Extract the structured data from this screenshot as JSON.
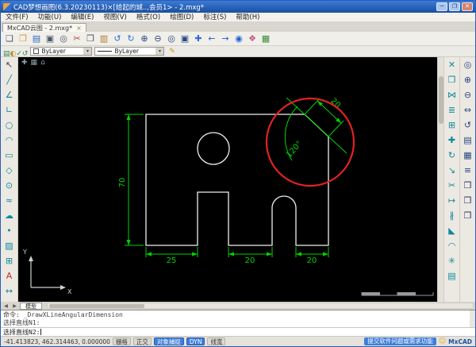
{
  "window": {
    "title": "CAD梦想画图(6.3.20230113)×[给起的城..,会员1> - 2.mxg*",
    "minimize": "─",
    "maximize": "❐",
    "close": "✕"
  },
  "menu": {
    "items": [
      {
        "label": "文件(F)",
        "name": "menu-file"
      },
      {
        "label": "功能(U)",
        "name": "menu-function"
      },
      {
        "label": "编辑(E)",
        "name": "menu-edit"
      },
      {
        "label": "视图(V)",
        "name": "menu-view"
      },
      {
        "label": "格式(O)",
        "name": "menu-format"
      },
      {
        "label": "绘图(D)",
        "name": "menu-draw"
      },
      {
        "label": "标注(S)",
        "name": "menu-dimension"
      },
      {
        "label": "帮助(H)",
        "name": "menu-help"
      }
    ]
  },
  "doc_tab": {
    "label": "MxCAD云图 - 2.mxg*",
    "close_glyph": "×"
  },
  "toolbar_main": {
    "icons": [
      {
        "name": "new-icon",
        "glyph": "❏",
        "color": "#4a5568"
      },
      {
        "name": "open-icon",
        "glyph": "❐",
        "color": "#d89a2b"
      },
      {
        "name": "save-icon",
        "glyph": "▤",
        "color": "#2f66c4"
      },
      {
        "name": "print-icon",
        "glyph": "▣",
        "color": "#4a5568"
      },
      {
        "name": "preview-icon",
        "glyph": "◎",
        "color": "#4a5568"
      },
      {
        "name": "cut-icon",
        "glyph": "✂",
        "color": "#b04848"
      },
      {
        "name": "copy-icon",
        "glyph": "❒",
        "color": "#4a5568"
      },
      {
        "name": "paste-icon",
        "glyph": "▥",
        "color": "#b07830"
      },
      {
        "name": "undo-icon",
        "glyph": "↺",
        "color": "#2e6fd6"
      },
      {
        "name": "redo-icon",
        "glyph": "↻",
        "color": "#2e6fd6"
      },
      {
        "name": "zoom-in-icon",
        "glyph": "⊕",
        "color": "#27477e"
      },
      {
        "name": "zoom-out-icon",
        "glyph": "⊖",
        "color": "#27477e"
      },
      {
        "name": "zoom-extents-icon",
        "glyph": "◎",
        "color": "#27477e"
      },
      {
        "name": "zoom-window-icon",
        "glyph": "▣",
        "color": "#27477e"
      },
      {
        "name": "pan-icon",
        "glyph": "✚",
        "color": "#2e6fd6"
      },
      {
        "name": "back-icon",
        "glyph": "←",
        "color": "#1f5fd0"
      },
      {
        "name": "forward-icon",
        "glyph": "→",
        "color": "#1f5fd0"
      },
      {
        "name": "globe-icon",
        "glyph": "◉",
        "color": "#1f5fd0"
      },
      {
        "name": "palette-icon",
        "glyph": "❖",
        "color": "#c2567a"
      },
      {
        "name": "table-icon",
        "glyph": "▦",
        "color": "#3a8a3a"
      }
    ]
  },
  "properties_bar": {
    "icons": [
      {
        "name": "layer-manager-icon",
        "glyph": "▤",
        "color": "#2f8a5a"
      },
      {
        "name": "layer-states-icon",
        "glyph": "◐",
        "color": "#b8962b"
      },
      {
        "name": "layer-current-icon",
        "glyph": "✓",
        "color": "#2f8a5a"
      },
      {
        "name": "layer-previous-icon",
        "glyph": "↺",
        "color": "#2f8a5a"
      }
    ],
    "color_label": "ByLayer",
    "linetype_label": "ByLayer",
    "dd_arrow": "▾",
    "pencil_glyph": "✎"
  },
  "left_toolbar": {
    "icons": [
      {
        "name": "pointer-tool-icon",
        "glyph": "↖",
        "color": "#445"
      },
      {
        "name": "line-tool-icon",
        "glyph": "╱",
        "color": "#12889b"
      },
      {
        "name": "xline-tool-icon",
        "glyph": "∠",
        "color": "#12889b"
      },
      {
        "name": "polyline-tool-icon",
        "glyph": "∟",
        "color": "#12889b"
      },
      {
        "name": "circle-tool-icon",
        "glyph": "○",
        "color": "#12889b"
      },
      {
        "name": "arc-tool-icon",
        "glyph": "◠",
        "color": "#12889b"
      },
      {
        "name": "rectangle-tool-icon",
        "glyph": "▭",
        "color": "#12889b"
      },
      {
        "name": "polygon-tool-icon",
        "glyph": "◇",
        "color": "#12889b"
      },
      {
        "name": "ellipse-tool-icon",
        "glyph": "⊙",
        "color": "#12889b"
      },
      {
        "name": "spline-tool-icon",
        "glyph": "≈",
        "color": "#12889b"
      },
      {
        "name": "revcloud-tool-icon",
        "glyph": "☁",
        "color": "#12889b"
      },
      {
        "name": "point-tool-icon",
        "glyph": "•",
        "color": "#12889b"
      },
      {
        "name": "hatch-tool-icon",
        "glyph": "▨",
        "color": "#12889b"
      },
      {
        "name": "block-tool-icon",
        "glyph": "⊞",
        "color": "#12889b"
      },
      {
        "name": "text-tool-icon",
        "glyph": "A",
        "color": "#c03030"
      },
      {
        "name": "dimension-tool-icon",
        "glyph": "↔",
        "color": "#12889b"
      }
    ]
  },
  "modify_toolbar": {
    "icons": [
      {
        "name": "erase-icon",
        "glyph": "✕",
        "color": "#12889b"
      },
      {
        "name": "copy-obj-icon",
        "glyph": "❐",
        "color": "#12889b"
      },
      {
        "name": "mirror-icon",
        "glyph": "⋈",
        "color": "#12889b"
      },
      {
        "name": "offset-icon",
        "glyph": "≣",
        "color": "#12889b"
      },
      {
        "name": "array-icon",
        "glyph": "⊞",
        "color": "#12889b"
      },
      {
        "name": "move-icon",
        "glyph": "✚",
        "color": "#12889b"
      },
      {
        "name": "rotate-icon",
        "glyph": "↻",
        "color": "#12889b"
      },
      {
        "name": "scale-icon",
        "glyph": "↘",
        "color": "#12889b"
      },
      {
        "name": "trim-icon",
        "glyph": "✂",
        "color": "#12889b"
      },
      {
        "name": "extend-icon",
        "glyph": "↦",
        "color": "#12889b"
      },
      {
        "name": "break-icon",
        "glyph": "∦",
        "color": "#12889b"
      },
      {
        "name": "chamfer-icon",
        "glyph": "◣",
        "color": "#12889b"
      },
      {
        "name": "fillet-icon",
        "glyph": "◠",
        "color": "#12889b"
      },
      {
        "name": "explode-icon",
        "glyph": "✳",
        "color": "#12889b"
      },
      {
        "name": "properties-icon",
        "glyph": "▤",
        "color": "#12889b"
      }
    ]
  },
  "view_toolbar": {
    "icons": [
      {
        "name": "redraw-icon",
        "glyph": "◎",
        "color": "#27477e"
      },
      {
        "name": "zoom-in-view-icon",
        "glyph": "⊕",
        "color": "#27477e"
      },
      {
        "name": "zoom-out-view-icon",
        "glyph": "⊖",
        "color": "#27477e"
      },
      {
        "name": "pan-view-icon",
        "glyph": "⇔",
        "color": "#27477e"
      },
      {
        "name": "orbit-icon",
        "glyph": "↺",
        "color": "#27477e"
      },
      {
        "name": "named-views-icon",
        "glyph": "▤",
        "color": "#27477e"
      },
      {
        "name": "render-icon",
        "glyph": "▦",
        "color": "#27477e"
      },
      {
        "name": "ucs-icon",
        "glyph": "≡",
        "color": "#27477e"
      },
      {
        "name": "view-cube-se-icon",
        "glyph": "❒",
        "color": "#27335c"
      },
      {
        "name": "view-cube-sw-icon",
        "glyph": "❒",
        "color": "#27335c"
      },
      {
        "name": "view-cube-top-icon",
        "glyph": "❒",
        "color": "#27335c"
      }
    ]
  },
  "canvas": {
    "nav": [
      {
        "name": "pan-nav-icon",
        "glyph": "✚"
      },
      {
        "name": "grid-nav-icon",
        "glyph": "▦"
      },
      {
        "name": "home-nav-icon",
        "glyph": "⌂"
      }
    ],
    "dims": {
      "left": "70",
      "top": "20",
      "angle": "120°",
      "b1": "25",
      "b2": "20",
      "b3": "20"
    },
    "ucs": {
      "x": "X",
      "y": "Y"
    },
    "colors": {
      "entity": "#f0f0f0",
      "dimension": "#00d400",
      "highlight": "#e32222"
    }
  },
  "model_bar": {
    "prev_glyph": "◀",
    "next_glyph": "▶",
    "tab": "模型"
  },
  "command": {
    "history": [
      {
        "label": "命令: _DrawXLineAngularDimension",
        "name": "cmd-history-line"
      },
      {
        "label": "选择直线N1:",
        "name": "cmd-history-line"
      }
    ],
    "prompt": "选择直线N2:"
  },
  "status": {
    "coords": "-41.413823, 462.314463, 0.000000",
    "toggles": [
      {
        "label": "栅格",
        "on": false,
        "name": "grid-toggle"
      },
      {
        "label": "正交",
        "on": false,
        "name": "ortho-toggle"
      },
      {
        "label": "对象捕捉",
        "on": true,
        "name": "osnap-toggle"
      },
      {
        "label": "DYN",
        "on": true,
        "name": "dyn-toggle"
      },
      {
        "label": "线宽",
        "on": false,
        "name": "lineweight-toggle"
      }
    ],
    "feedback": "提交软件问题或需求功能",
    "smiley": "☺",
    "brand": "MxCAD"
  }
}
